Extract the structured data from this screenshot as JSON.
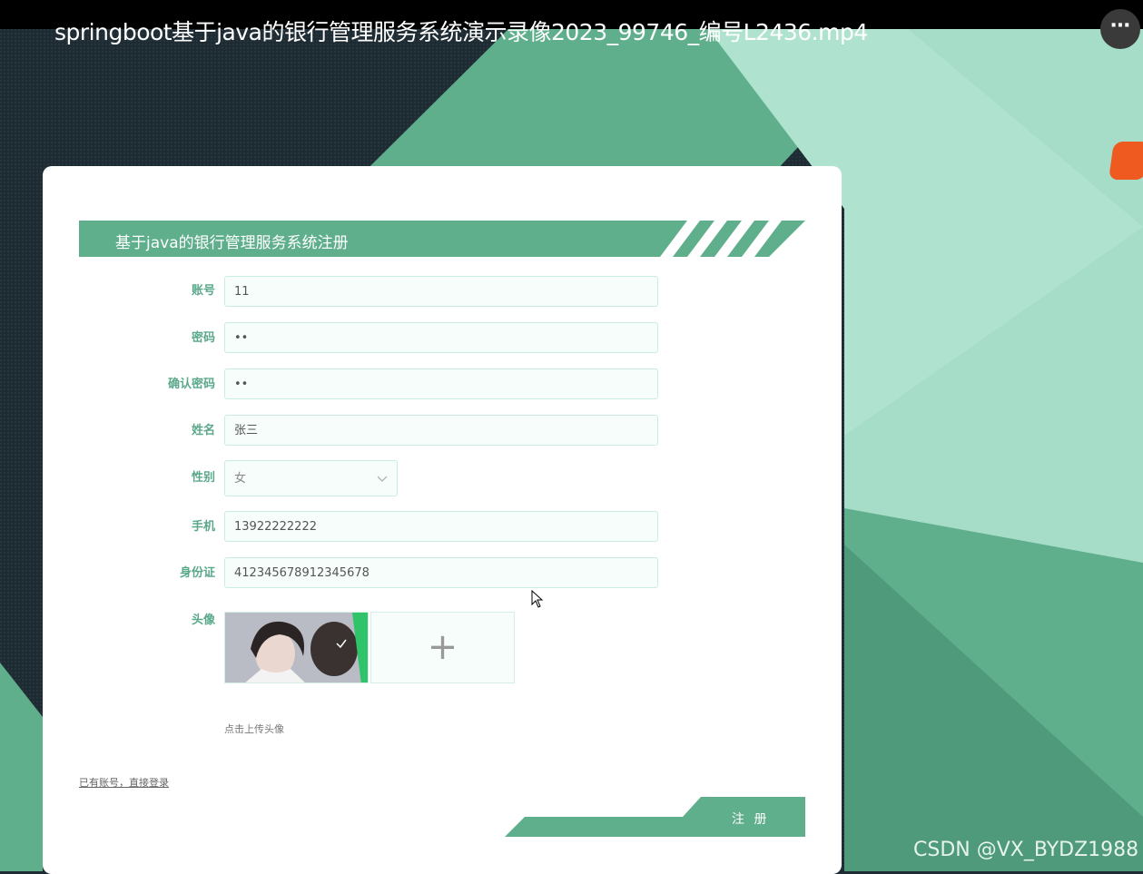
{
  "video": {
    "title": "springboot基于java的银行管理服务系统演示录像2023_99746_编号L2436.mp4",
    "more_label": "⋯",
    "watermark": "CSDN @VX_BYDZ1988"
  },
  "form": {
    "title": "基于java的银行管理服务系统注册",
    "fields": [
      {
        "label": "账号",
        "value": "11"
      },
      {
        "label": "密码",
        "value": "••"
      },
      {
        "label": "确认密码",
        "value": "••"
      },
      {
        "label": "姓名",
        "value": "张三"
      },
      {
        "label": "性别",
        "value": "女"
      },
      {
        "label": "手机",
        "value": "13922222222"
      },
      {
        "label": "身份证",
        "value": "412345678912345678"
      },
      {
        "label": "头像",
        "value": ""
      }
    ],
    "upload_plus": "+",
    "upload_hint": "点击上传头像",
    "login_link": "已有账号，直接登录",
    "register_button": "注 册"
  },
  "colors": {
    "accent": "#5fae8c",
    "accent_light": "#b0e3cf",
    "dark_bg": "#1f2c33"
  }
}
